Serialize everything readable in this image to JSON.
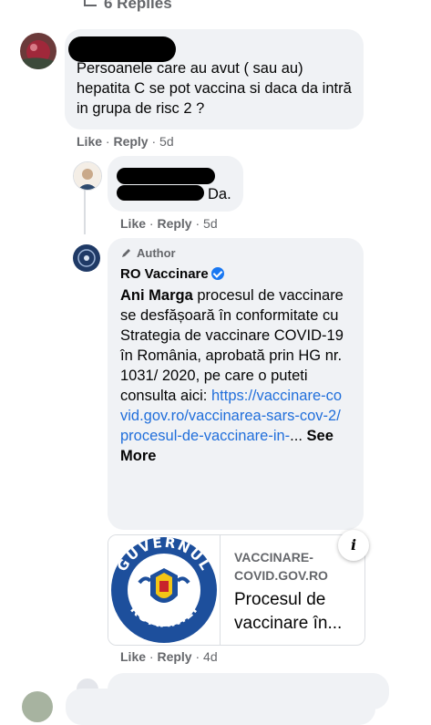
{
  "top": {
    "replies_label": "6 Replies"
  },
  "comment1": {
    "text": "Persoanele care au avut ( sau au) hepatita C se pot vaccina si daca da intră in grupa de risc 2 ?",
    "actions": {
      "like": "Like",
      "reply": "Reply",
      "time": "5d"
    }
  },
  "comment2": {
    "text_visible": "Da.",
    "actions": {
      "like": "Like",
      "reply": "Reply",
      "time": "5d"
    }
  },
  "comment3": {
    "badge": "Author",
    "author": "RO Vaccinare",
    "mention": "Ani Marga",
    "text": "procesul de vaccinare se desfășoară în conformitate cu Strategia de vaccinare COVID-19 în România, aprobată prin HG nr. 1031/ 2020, pe care o puteti consulta aici:",
    "link": "https://vaccinare-covid.gov.ro/vaccinarea-sars-cov-2/procesul-de-vaccinare-in-",
    "ellipsis": "...",
    "see_more": "See More",
    "preview": {
      "domain": "VACCINARE-COVID.GOV.RO",
      "title": "Procesul de vaccinare în...",
      "info_icon": "i"
    },
    "actions": {
      "like": "Like",
      "reply": "Reply",
      "time": "4d"
    }
  },
  "colors": {
    "link": "#216fdb",
    "meta": "#65676b",
    "bubble": "#f0f2f5",
    "verified": "#1877f2",
    "seal": "#1d4f9c"
  }
}
